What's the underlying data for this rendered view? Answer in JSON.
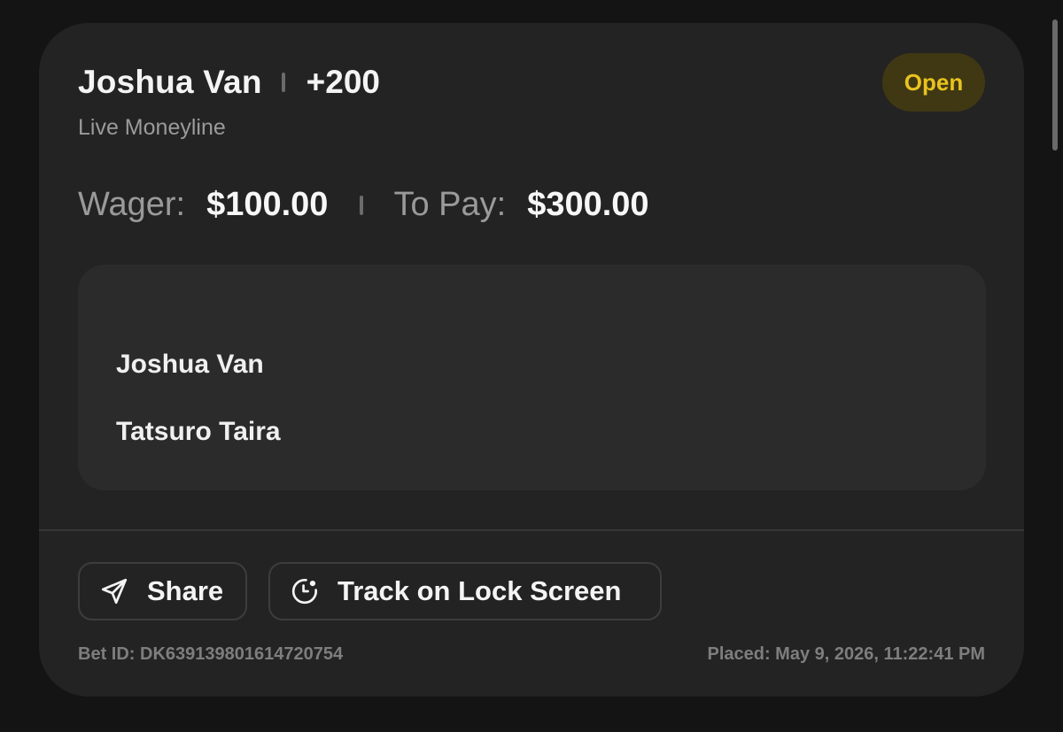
{
  "bet": {
    "selection": "Joshua Van",
    "odds": "+200",
    "market": "Live Moneyline",
    "status": "Open"
  },
  "amounts": {
    "wager_label": "Wager:",
    "wager_value": "$100.00",
    "to_pay_label": "To Pay:",
    "to_pay_value": "$300.00"
  },
  "matchup": {
    "competitors": [
      "Joshua Van",
      "Tatsuro Taira"
    ]
  },
  "actions": {
    "share_label": "Share",
    "track_label": "Track on Lock Screen"
  },
  "footer": {
    "bet_id": "Bet ID: DK639139801614720754",
    "placed": "Placed: May 9, 2026, 11:22:41 PM"
  },
  "colors": {
    "background": "#141414",
    "card": "#232323",
    "status_bg": "#3f3813",
    "status_text": "#e9c21e"
  },
  "icons": {
    "share": "send-icon",
    "track": "clock-icon"
  }
}
